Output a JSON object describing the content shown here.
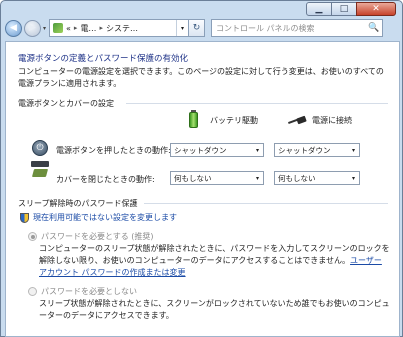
{
  "window": {
    "minimize_label": "▁",
    "maximize_label": "□",
    "close_label": "✕"
  },
  "nav": {
    "back_glyph": "◀",
    "forward_glyph": "▶",
    "dropdown_glyph": "▾",
    "breadcrumb": [
      "«",
      "電…",
      "システ…"
    ],
    "breadcrumb_sep": "▸",
    "refresh_glyph": "↻",
    "search_placeholder": "コントロール パネルの検索",
    "search_glyph": "🔍"
  },
  "page": {
    "title": "電源ボタンの定義とパスワード保護の有効化",
    "description": "コンピューターの電源設定を選択できます。このページの設定に対して行う変更は、お使いのすべての電源プランに適用されます。",
    "buttons_section": "電源ボタンとカバーの設定",
    "col_battery": "バッテリ駆動",
    "col_plugged": "電源に接続",
    "power_button_label": "電源ボタンを押したときの動作:",
    "power_button_battery": "シャットダウン",
    "power_button_plugged": "シャットダウン",
    "lid_label": "カバーを閉じたときの動作:",
    "lid_battery": "何もしない",
    "lid_plugged": "何もしない",
    "select_arrow": "▾",
    "power_glyph": "⏻",
    "password_section": "スリープ解除時のパスワード保護",
    "change_unavailable_link": "現在利用可能ではない設定を変更します",
    "require_password_label": "パスワードを必要とする (推奨)",
    "require_password_desc": "コンピューターのスリープ状態が解除されたときに、パスワードを入力してスクリーンのロックを解除しない限り、お使いのコンピューターのデータにアクセスすることはできません。",
    "user_account_link": "ユーザー アカウント パスワードの作成または変更",
    "no_password_label": "パスワードを必要としない",
    "no_password_desc": "スリープ状態が解除されたときに、スクリーンがロックされていないため誰でもお使いのコンピューターのデータにアクセスできます。"
  },
  "colors": {
    "title_blue": "#1e3287",
    "link_blue": "#1b4ba6",
    "frame": "#c9dcef",
    "disabled_text": "#8a8a8a"
  },
  "icons": {
    "battery": "battery-icon",
    "plug": "power-plug-icon",
    "power": "power-button-icon",
    "lid": "laptop-lid-icon",
    "shield": "uac-shield-icon",
    "control_panel": "control-panel-icon"
  },
  "state": {
    "require_password_selected": true,
    "options_enabled": false
  }
}
